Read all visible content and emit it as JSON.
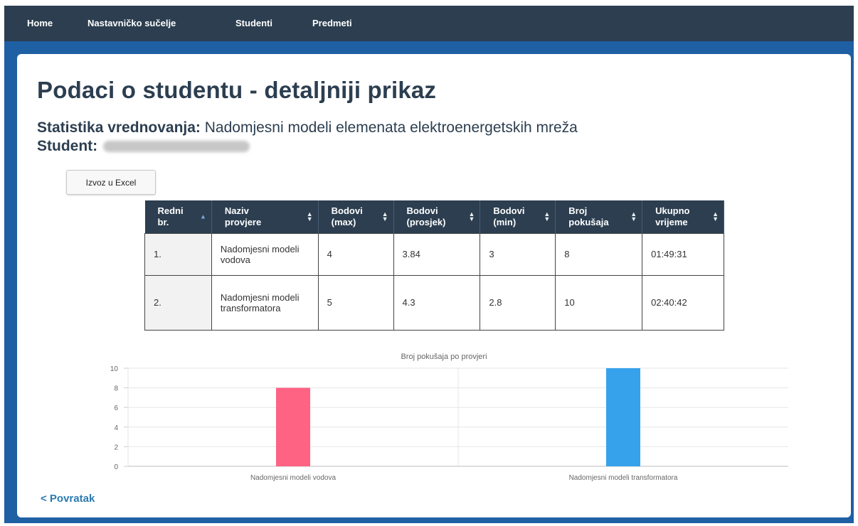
{
  "nav": {
    "items": [
      "Home",
      "Nastavničko sučelje",
      "Studenti",
      "Predmeti"
    ]
  },
  "page": {
    "title": "Podaci o studentu - detaljniji prikaz",
    "stat_label": "Statistika vrednovanja:",
    "course_name": "Nadomjesni modeli elemenata elektroenergetskih mreža",
    "student_label": "Student:",
    "export_button": "Izvoz u Excel",
    "back_link": "< Povratak"
  },
  "table": {
    "headers": [
      [
        "Redni",
        "br."
      ],
      [
        "Naziv",
        "provjere"
      ],
      [
        "Bodovi",
        "(max)"
      ],
      [
        "Bodovi",
        "(prosjek)"
      ],
      [
        "Bodovi",
        "(min)"
      ],
      [
        "Broj",
        "pokušaja"
      ],
      [
        "Ukupno",
        "vrijeme"
      ]
    ],
    "rows": [
      [
        "1.",
        "Nadomjesni modeli vodova",
        "4",
        "3.84",
        "3",
        "8",
        "01:49:31"
      ],
      [
        "2.",
        "Nadomjesni modeli transformatora",
        "5",
        "4.3",
        "2.8",
        "10",
        "02:40:42"
      ]
    ]
  },
  "colors": {
    "nav_bg": "#2c3e50",
    "frame_bg": "#1f5fa3",
    "bar_1": "#ff6384",
    "bar_2": "#36a2eb",
    "link": "#2a7ab0"
  },
  "chart_data": {
    "type": "bar",
    "title": "Broj pokušaja po provjeri",
    "categories": [
      "Nadomjesni modeli vodova",
      "Nadomjesni modeli transformatora"
    ],
    "values": [
      8,
      10
    ],
    "ylim": [
      0,
      10
    ],
    "yticks": [
      0,
      2,
      4,
      6,
      8,
      10
    ],
    "grid": true,
    "legend": "none"
  }
}
